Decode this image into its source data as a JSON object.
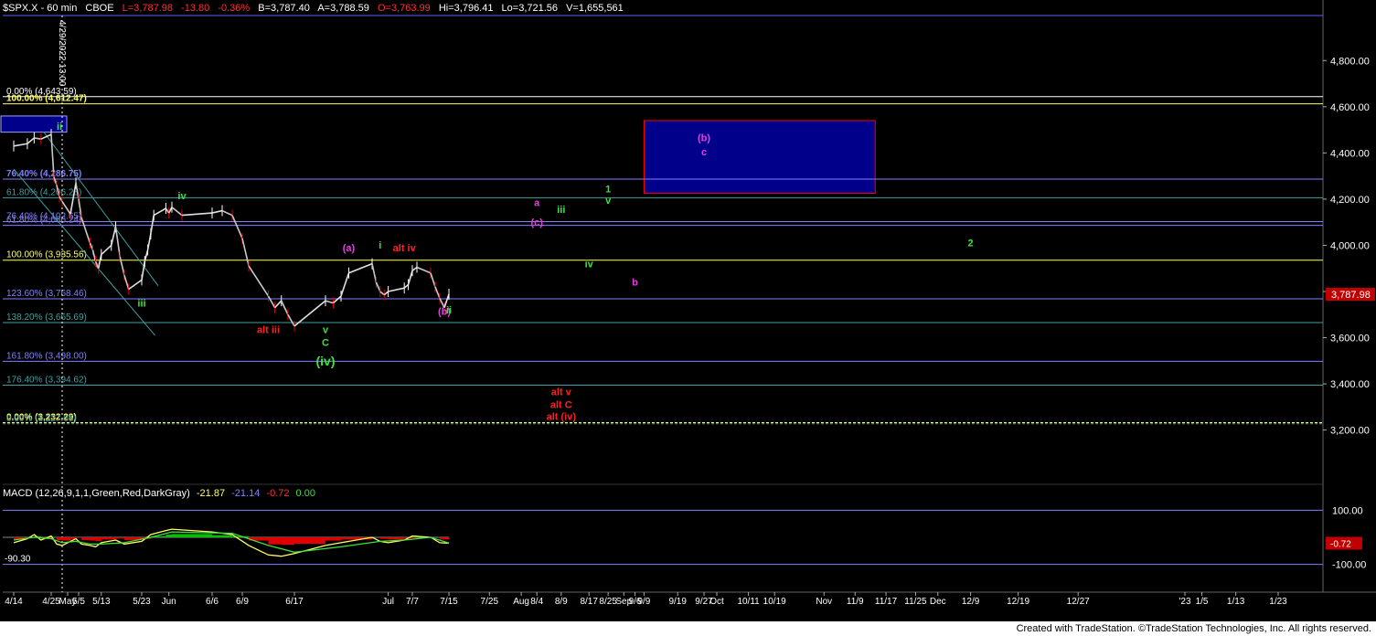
{
  "header": {
    "symbol": "$SPX.X - 60 min",
    "exchange": "CBOE",
    "last": "L=3,787.98",
    "change": "-13.80",
    "change_pct": "-0.36%",
    "bid": "B=3,787.40",
    "ask": "A=3,788.59",
    "open": "O=3,763.99",
    "high": "Hi=3,796.41",
    "low": "Lo=3,721.56",
    "volume": "V=1,655,561"
  },
  "macd": {
    "label": "MACD (12,26,9,1,1,Green,Red,DarkGray)",
    "v1": "-21.87",
    "v2": "-21.14",
    "v3": "-0.72",
    "v4": "0.00",
    "marker": "-0.72",
    "low_label": "-90.30"
  },
  "footer": {
    "text": "Created with TradeStation. ©TradeStation Technologies, Inc. All rights reserved."
  },
  "vline_label": "4/29/2022 13:00",
  "colors": {
    "background": "#000000",
    "up": "#00c000",
    "down": "#e00000",
    "price": "#ffffff",
    "fib_yellow": "#ffff66",
    "fib_blue": "#8080ff",
    "fib_teal": "#40a0a0",
    "green_label": "#40e040",
    "magenta_label": "#e040e0",
    "red_label": "#ff2020",
    "box_fill": "#00008b",
    "box_border": "#ff0000",
    "price_tag": "#c00000"
  },
  "chart_data": {
    "type": "line",
    "title": "$SPX.X - 60 min",
    "y_ticks": [
      {
        "value": 4800,
        "label": "4,800.00"
      },
      {
        "value": 4600,
        "label": "4,600.00"
      },
      {
        "value": 4400,
        "label": "4,400.00"
      },
      {
        "value": 4200,
        "label": "4,200.00"
      },
      {
        "value": 4000,
        "label": "4,000.00"
      },
      {
        "value": 3800,
        "label": "3,800.00"
      },
      {
        "value": 3600,
        "label": "3,600.00"
      },
      {
        "value": 3400,
        "label": "3,400.00"
      },
      {
        "value": 3200,
        "label": "3,200.00"
      }
    ],
    "ylim": [
      3155,
      4995
    ],
    "last_price": {
      "value": 3787.98,
      "label": "3,787.98"
    },
    "x_labels": [
      "4/14",
      "4/25",
      "May",
      "5/5",
      "5/13",
      "5/23",
      "Jun",
      "6/6",
      "6/9",
      "6/17",
      "Jul",
      "7/7",
      "7/15",
      "7/25",
      "Aug",
      "8/4",
      "8/9",
      "8/17",
      "8/25",
      "Sep",
      "9/6",
      "9/9",
      "9/19",
      "9/27",
      "Oct",
      "10/11",
      "10/19",
      "Nov",
      "11/9",
      "11/17",
      "11/25",
      "Dec",
      "12/9",
      "12/19",
      "12/27",
      "'23",
      "1/5",
      "1/13",
      "1/23"
    ],
    "price": [
      [
        "4/14",
        4430
      ],
      [
        "4/18",
        4440
      ],
      [
        "4/20",
        4465
      ],
      [
        "4/22",
        4460
      ],
      [
        "4/25",
        4480
      ],
      [
        "4/26",
        4295
      ],
      [
        "4/27",
        4260
      ],
      [
        "4/28",
        4210
      ],
      [
        "4/29",
        4190
      ],
      [
        "5/2",
        4135
      ],
      [
        "5/4",
        4270
      ],
      [
        "5/5",
        4200
      ],
      [
        "5/6",
        4120
      ],
      [
        "5/9",
        4010
      ],
      [
        "5/10",
        3980
      ],
      [
        "5/11",
        3930
      ],
      [
        "5/12",
        3900
      ],
      [
        "5/13",
        3960
      ],
      [
        "5/16",
        4000
      ],
      [
        "5/17",
        4080
      ],
      [
        "5/18",
        3950
      ],
      [
        "5/19",
        3870
      ],
      [
        "5/20",
        3810
      ],
      [
        "5/23",
        3850
      ],
      [
        "5/24",
        3930
      ],
      [
        "5/25",
        3980
      ],
      [
        "5/26",
        4050
      ],
      [
        "5/27",
        4130
      ],
      [
        "5/31",
        4160
      ],
      [
        "6/1",
        4140
      ],
      [
        "6/2",
        4165
      ],
      [
        "6/3",
        4130
      ],
      [
        "6/6",
        4140
      ],
      [
        "6/7",
        4150
      ],
      [
        "6/8",
        4130
      ],
      [
        "6/9",
        4030
      ],
      [
        "6/10",
        3910
      ],
      [
        "6/13",
        3780
      ],
      [
        "6/14",
        3730
      ],
      [
        "6/15",
        3760
      ],
      [
        "6/16",
        3700
      ],
      [
        "6/17",
        3650
      ],
      [
        "6/21",
        3760
      ],
      [
        "6/22",
        3750
      ],
      [
        "6/23",
        3780
      ],
      [
        "6/24",
        3880
      ],
      [
        "6/27",
        3920
      ],
      [
        "6/28",
        3840
      ],
      [
        "6/29",
        3800
      ],
      [
        "6/30",
        3785
      ],
      [
        "7/1",
        3800
      ],
      [
        "7/5",
        3815
      ],
      [
        "7/6",
        3830
      ],
      [
        "7/7",
        3890
      ],
      [
        "7/8",
        3905
      ],
      [
        "7/11",
        3880
      ],
      [
        "7/12",
        3820
      ],
      [
        "7/13",
        3770
      ],
      [
        "7/14",
        3730
      ],
      [
        "7/15",
        3788
      ]
    ],
    "fib_levels": [
      {
        "label": "0.00% (4,643.59)",
        "value": 4643.59,
        "color": "#ffffff",
        "label_color": "#ffffff"
      },
      {
        "label": "100.00% (4,612.47)",
        "value": 4612.47,
        "color": "#ffff66",
        "label_color": "#ffff66",
        "bold": true
      },
      {
        "label": "76.40% (4,286.75)",
        "value": 4286.75,
        "color": "#8080ff",
        "label_color": "#8080ff",
        "bold": true
      },
      {
        "label": "61.80% (4,206.28)",
        "value": 4206.28,
        "color": "#40a0a0",
        "label_color": "#40a0a0"
      },
      {
        "label": "76.40% (4,102.65)",
        "value": 4102.65,
        "color": "#8080ff",
        "label_color": "#8080ff"
      },
      {
        "label": "61.80% (4,086.24)",
        "value": 4086.24,
        "color": "#8080ff",
        "label_color": "#8080ff"
      },
      {
        "label": "100.00% (3,935.56)",
        "value": 3935.56,
        "color": "#ffff66",
        "label_color": "#ffff66"
      },
      {
        "label": "123.60% (3,768.46)",
        "value": 3768.46,
        "color": "#8080ff",
        "label_color": "#8080ff"
      },
      {
        "label": "138.20% (3,665.69)",
        "value": 3665.69,
        "color": "#40a0a0",
        "label_color": "#40a0a0"
      },
      {
        "label": "161.80% (3,498.00)",
        "value": 3498.0,
        "color": "#8080ff",
        "label_color": "#8080ff"
      },
      {
        "label": "176.40% (3,394.62)",
        "value": 3394.62,
        "color": "#40a0a0",
        "label_color": "#40a0a0"
      },
      {
        "label": "0.00% (3,232.29)",
        "value": 3232.29,
        "color": "#ffff66",
        "label_color": "#ffff66",
        "bold": true
      },
      {
        "label": "0.00% (3,227.05)",
        "value": 3227.05,
        "color": "#40a0a0",
        "label_color": "#40a0a0"
      }
    ],
    "macd_ticks": [
      {
        "value": 100,
        "label": "100.00"
      },
      {
        "value": -100,
        "label": "-100.00"
      }
    ],
    "macd_ylim": [
      -135,
      135
    ],
    "macd_values": [
      [
        "4/14",
        -20
      ],
      [
        "4/18",
        -5
      ],
      [
        "4/20",
        10
      ],
      [
        "4/22",
        -10
      ],
      [
        "4/25",
        5
      ],
      [
        "4/27",
        -25
      ],
      [
        "4/29",
        -30
      ],
      [
        "5/2",
        -15
      ],
      [
        "5/4",
        -5
      ],
      [
        "5/6",
        -25
      ],
      [
        "5/9",
        -30
      ],
      [
        "5/11",
        -35
      ],
      [
        "5/13",
        -20
      ],
      [
        "5/17",
        -10
      ],
      [
        "5/19",
        -25
      ],
      [
        "5/23",
        -15
      ],
      [
        "5/26",
        10
      ],
      [
        "5/31",
        25
      ],
      [
        "6/2",
        30
      ],
      [
        "6/6",
        20
      ],
      [
        "6/8",
        10
      ],
      [
        "6/10",
        -30
      ],
      [
        "6/13",
        -65
      ],
      [
        "6/15",
        -70
      ],
      [
        "6/17",
        -60
      ],
      [
        "6/21",
        -30
      ],
      [
        "6/23",
        -20
      ],
      [
        "6/27",
        0
      ],
      [
        "6/29",
        -15
      ],
      [
        "7/1",
        -20
      ],
      [
        "7/5",
        -10
      ],
      [
        "7/7",
        5
      ],
      [
        "7/11",
        0
      ],
      [
        "7/13",
        -20
      ],
      [
        "7/15",
        -21.87
      ]
    ],
    "macd_signal": [
      [
        "4/14",
        -10
      ],
      [
        "4/20",
        0
      ],
      [
        "4/25",
        -5
      ],
      [
        "4/29",
        -20
      ],
      [
        "5/4",
        -15
      ],
      [
        "5/9",
        -25
      ],
      [
        "5/13",
        -25
      ],
      [
        "5/19",
        -20
      ],
      [
        "5/26",
        0
      ],
      [
        "6/2",
        20
      ],
      [
        "6/8",
        15
      ],
      [
        "6/13",
        -30
      ],
      [
        "6/17",
        -55
      ],
      [
        "6/23",
        -35
      ],
      [
        "6/29",
        -15
      ],
      [
        "7/5",
        -10
      ],
      [
        "7/11",
        0
      ],
      [
        "7/15",
        -21.14
      ]
    ],
    "wave_labels": [
      {
        "text": "ii",
        "x": "4/28",
        "y": 4500,
        "color": "#40e040"
      },
      {
        "text": "iii",
        "x": "5/23",
        "y": 3735,
        "color": "#40e040"
      },
      {
        "text": "iv",
        "x": "6/3",
        "y": 4200,
        "color": "#40e040"
      },
      {
        "text": "(a)",
        "x": "6/24",
        "y": 3975,
        "color": "#e040e0"
      },
      {
        "text": "i",
        "x": "6/29",
        "y": 3985,
        "color": "#40e040"
      },
      {
        "text": "alt iv",
        "x": "7/5",
        "y": 3975,
        "color": "#ff2020"
      },
      {
        "text": "alt iii",
        "x": "6/13",
        "y": 3620,
        "color": "#ff2020"
      },
      {
        "text": "v",
        "x": "6/21",
        "y": 3620,
        "color": "#40e040"
      },
      {
        "text": "C",
        "x": "6/21",
        "y": 3565,
        "color": "#40e040"
      },
      {
        "text": "(iv)",
        "x": "6/21",
        "y": 3480,
        "color": "#40e040",
        "big": true
      },
      {
        "text": "(b)",
        "x": "7/14",
        "y": 3700,
        "color": "#e040e0"
      },
      {
        "text": "ii",
        "x": "7/15",
        "y": 3705,
        "color": "#40e040"
      },
      {
        "text": "a",
        "x": "8/4",
        "y": 4170,
        "color": "#e040e0"
      },
      {
        "text": "(c)",
        "x": "8/4",
        "y": 4085,
        "color": "#e040e0"
      },
      {
        "text": "iii",
        "x": "8/9",
        "y": 4140,
        "color": "#40e040"
      },
      {
        "text": "iv",
        "x": "8/17",
        "y": 3905,
        "color": "#40e040"
      },
      {
        "text": "b",
        "x": "9/6",
        "y": 3825,
        "color": "#e040e0"
      },
      {
        "text": "1",
        "x": "8/25",
        "y": 4230,
        "color": "#40e040"
      },
      {
        "text": "v",
        "x": "8/25",
        "y": 4180,
        "color": "#40e040"
      },
      {
        "text": "(b)",
        "x": "9/27",
        "y": 4450,
        "color": "#e040e0"
      },
      {
        "text": "c",
        "x": "9/27",
        "y": 4390,
        "color": "#e040e0"
      },
      {
        "text": "2",
        "x": "12/9",
        "y": 3995,
        "color": "#40e040"
      },
      {
        "text": "alt v",
        "x": "8/9",
        "y": 3350,
        "color": "#ff2020"
      },
      {
        "text": "alt C",
        "x": "8/9",
        "y": 3295,
        "color": "#ff2020"
      },
      {
        "text": "alt (iv)",
        "x": "8/9",
        "y": 3245,
        "color": "#ff2020"
      }
    ]
  }
}
